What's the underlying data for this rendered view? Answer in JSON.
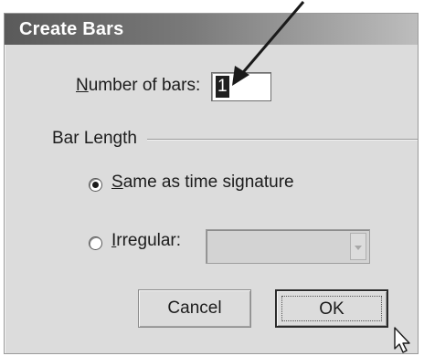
{
  "dialog": {
    "title": "Create Bars",
    "number_of_bars": {
      "label": "Number of bars:",
      "value": "1"
    },
    "bar_length_group": "Bar Length",
    "options": [
      {
        "label": "Same as time signature",
        "selected": true
      },
      {
        "label": "Irregular:",
        "selected": false
      }
    ],
    "irregular_select": {
      "value": "",
      "enabled": false
    },
    "buttons": {
      "cancel": "Cancel",
      "ok": "OK"
    }
  }
}
